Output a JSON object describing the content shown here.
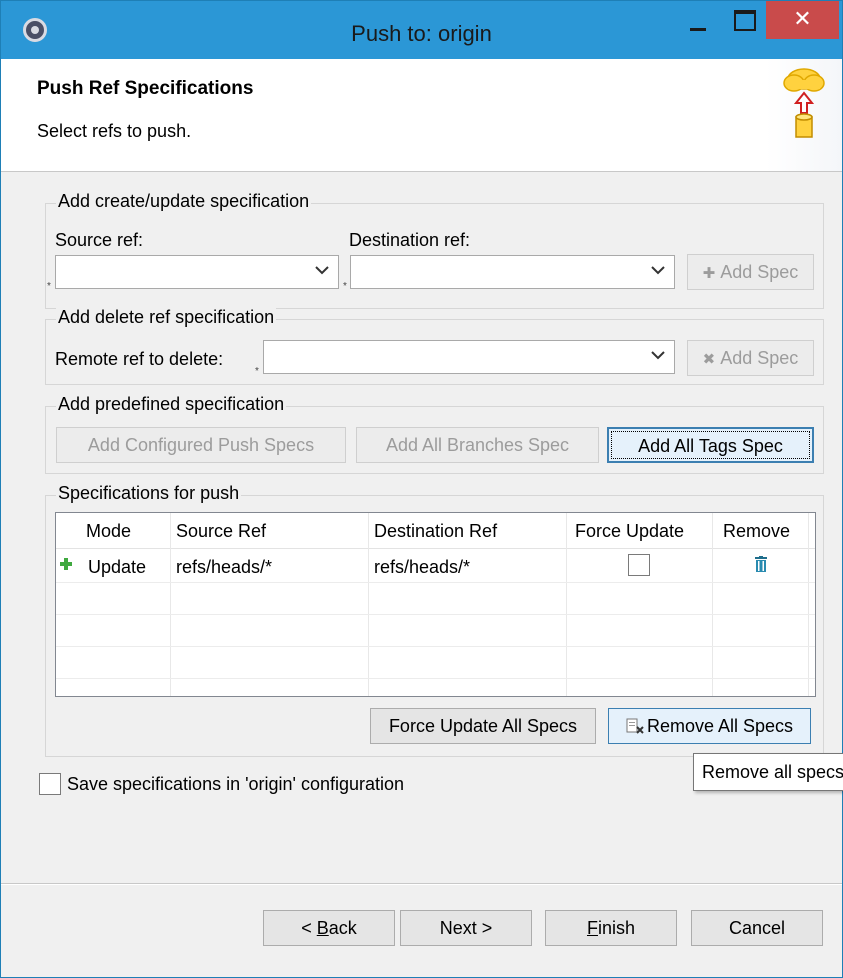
{
  "window": {
    "title": "Push to: origin",
    "close_glyph": "✕"
  },
  "banner": {
    "title": "Push Ref Specifications",
    "subtitle": "Select refs to push.",
    "icon": "cloud-push-icon"
  },
  "create_group": {
    "label": "Add create/update specification",
    "source_label": "Source ref:",
    "source_value": "",
    "destination_label": "Destination ref:",
    "destination_value": "",
    "add_spec_label": "Add Spec",
    "required_marker": "*"
  },
  "delete_group": {
    "label": "Add delete ref specification",
    "remote_label": "Remote ref to delete:",
    "remote_value": "",
    "add_spec_label": "Add Spec",
    "required_marker": "*"
  },
  "predefined_group": {
    "label": "Add predefined specification",
    "configured_label": "Add Configured Push Specs",
    "branches_label": "Add All Branches Spec",
    "tags_label": "Add All Tags Spec"
  },
  "specs_group": {
    "label": "Specifications for push",
    "columns": [
      "Mode",
      "Source Ref",
      "Destination Ref",
      "Force Update",
      "Remove"
    ],
    "rows": [
      {
        "mode": "Update",
        "source": "refs/heads/*",
        "destination": "refs/heads/*",
        "force_update": false
      }
    ],
    "force_all_label": "Force Update All Specs",
    "remove_all_label": "Remove All Specs"
  },
  "tooltip": {
    "text": "Remove all specs"
  },
  "save_checkbox": {
    "label": "Save specifications in 'origin' configuration",
    "checked": false
  },
  "footer": {
    "back_mnemonic": "B",
    "back_rest": "ack",
    "back_prefix": "< ",
    "next_label": "Next >",
    "finish_mnemonic": "F",
    "finish_rest": "inish",
    "cancel_label": "Cancel"
  },
  "colors": {
    "titlebar": "#2b97d6",
    "close": "#c94b4b",
    "dialog_bg": "#f0f0f0",
    "focus_border": "#3c7fb1"
  }
}
